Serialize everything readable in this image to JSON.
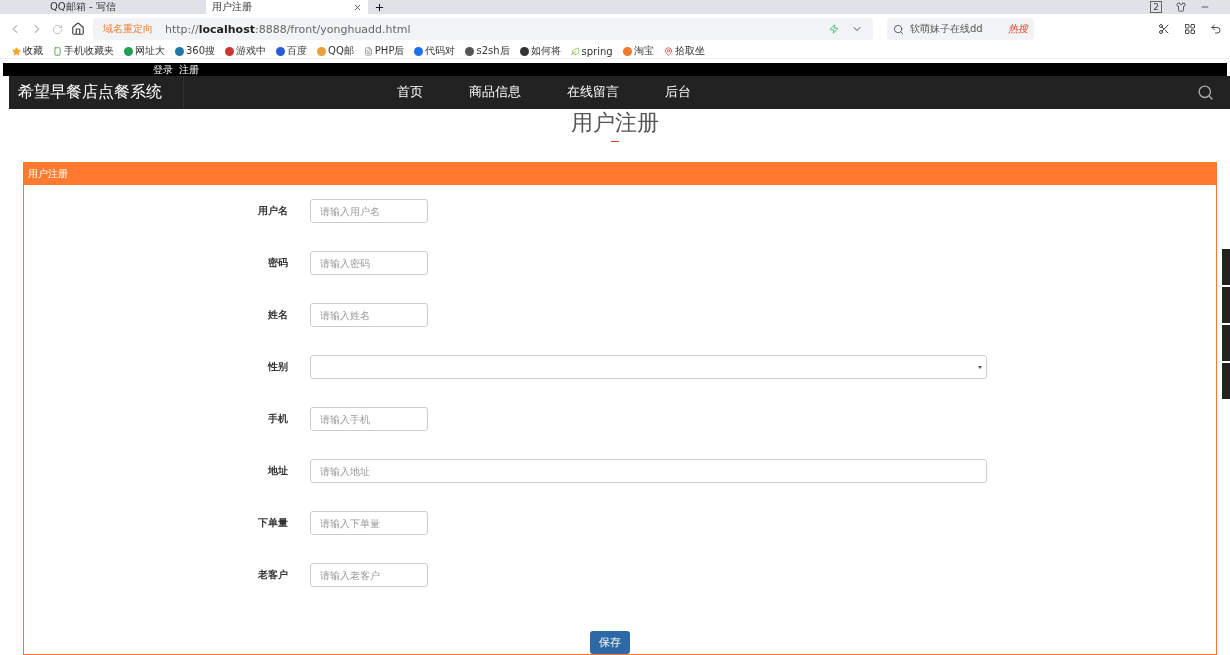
{
  "browser": {
    "tabs": [
      {
        "label": "QQ邮箱 - 写信",
        "selected": false
      },
      {
        "label": "用户注册",
        "selected": true
      }
    ],
    "tab_count": "2",
    "address": {
      "badge": "域名重定向",
      "url_prefix": "http://",
      "url_host": "localhost",
      "url_rest": ":8888/front/yonghuadd.html"
    },
    "search": {
      "placeholder": "软萌妹子在线dd",
      "hot": "热搜"
    },
    "bookmarks": [
      "收藏",
      "手机收藏夹",
      "网址大",
      "360搜",
      "游戏中",
      "百度",
      "QQ邮",
      "PHP后",
      "代码对",
      "s2sh后",
      "如何将",
      "spring",
      "淘宝",
      "拾取坐"
    ]
  },
  "topbar": {
    "links": [
      "登录",
      "注册"
    ]
  },
  "nav": {
    "brand": "希望早餐店点餐系统",
    "items": [
      "首页",
      "商品信息",
      "在线留言",
      "后台"
    ]
  },
  "page_title": "用户注册",
  "panel": {
    "title": "用户注册",
    "fields": [
      {
        "label": "用户名",
        "kind": "text",
        "placeholder": "请输入用户名"
      },
      {
        "label": "密码",
        "kind": "text",
        "placeholder": "请输入密码"
      },
      {
        "label": "姓名",
        "kind": "text",
        "placeholder": "请输入姓名"
      },
      {
        "label": "性别",
        "kind": "select"
      },
      {
        "label": "手机",
        "kind": "text",
        "placeholder": "请输入手机"
      },
      {
        "label": "地址",
        "kind": "wide",
        "placeholder": "请输入地址"
      },
      {
        "label": "下单量",
        "kind": "text",
        "placeholder": "请输入下单量"
      },
      {
        "label": "老客户",
        "kind": "text",
        "placeholder": "请输入老客户"
      }
    ],
    "button": "保存"
  }
}
